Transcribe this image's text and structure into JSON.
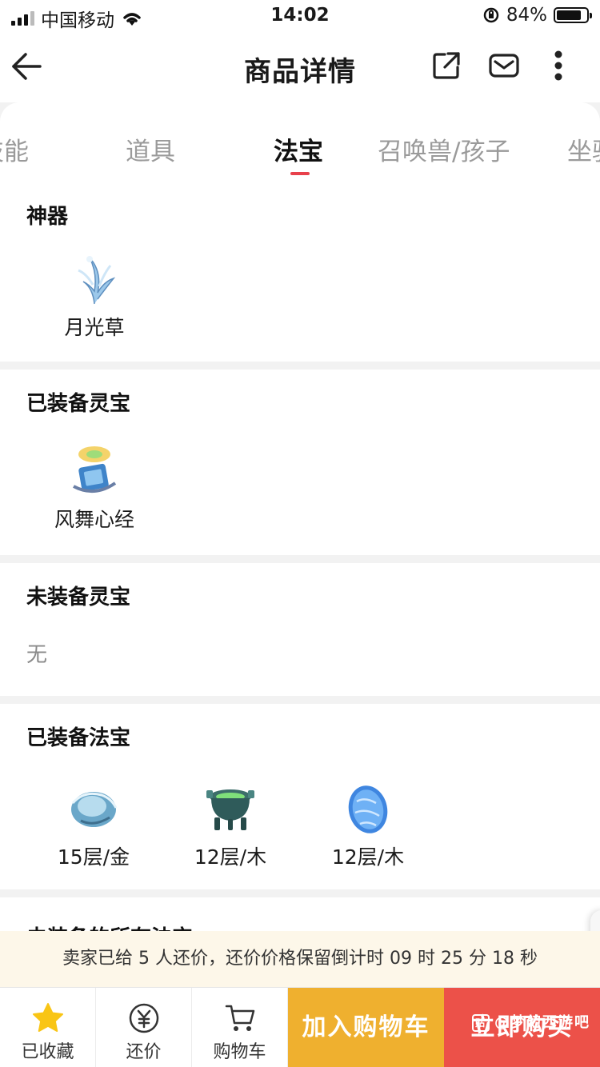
{
  "status_bar": {
    "carrier": "中国移动",
    "time": "14:02",
    "battery": "84%",
    "battery_level": 0.84
  },
  "nav": {
    "title": "商品详情",
    "icons": [
      "back-arrow-icon",
      "share-icon",
      "message-icon",
      "more-icon"
    ]
  },
  "tabs": [
    {
      "label": "技能"
    },
    {
      "label": "道具"
    },
    {
      "label": "法宝",
      "active": true
    },
    {
      "label": "召唤兽/孩子"
    },
    {
      "label": "坐骑"
    }
  ],
  "sections": {
    "artifact": {
      "title": "神器",
      "items": [
        {
          "name": "月光草",
          "icon": "moonlight-grass-icon"
        }
      ]
    },
    "equipped_lingbao": {
      "title": "已装备灵宝",
      "items": [
        {
          "name": "风舞心经",
          "icon": "wind-dance-scripture-icon"
        }
      ]
    },
    "unequipped_lingbao": {
      "title": "未装备灵宝",
      "empty_text": "无"
    },
    "equipped_fabao": {
      "title": "已装备法宝",
      "items": [
        {
          "name": "15层/金",
          "icon": "blue-orb-fabao-icon"
        },
        {
          "name": "12层/木",
          "icon": "bronze-cauldron-fabao-icon"
        },
        {
          "name": "12层/木",
          "icon": "blue-egg-fabao-icon"
        }
      ]
    },
    "unequipped_fabao": {
      "title": "未装备的所有法宝"
    }
  },
  "notice": {
    "text": "卖家已给 5 人还价，还价价格保留倒计时 09 时 25 分 18 秒"
  },
  "bottom_bar": {
    "favorite_label": "已收藏",
    "counter_offer_label": "还价",
    "cart_label": "购物车",
    "add_to_cart_label": "加入购物车",
    "buy_now_label": "立即购买",
    "watermark_text": "@梦幻西游吧",
    "watermark_badge": "贴"
  },
  "colors": {
    "accent_red": "#e8414b",
    "add_to_cart_bg": "#efb02f",
    "buy_now_bg": "#ec5149",
    "favorite_star": "#f9c515",
    "notice_bg": "#fdf7e9"
  }
}
